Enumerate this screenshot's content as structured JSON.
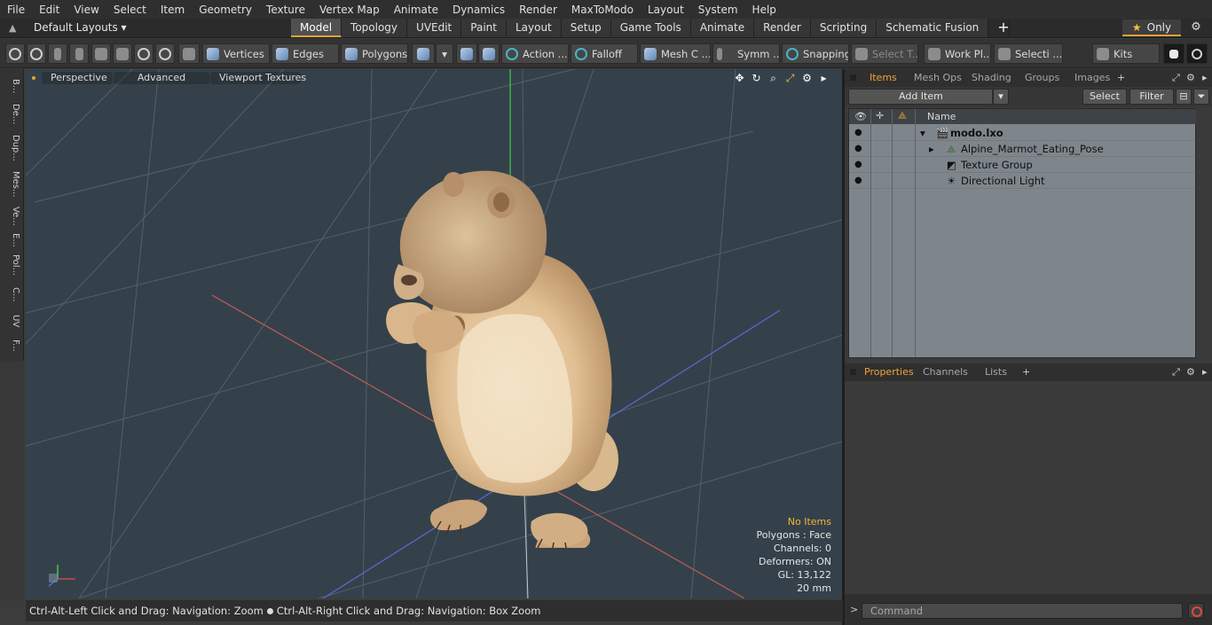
{
  "menu": [
    "File",
    "Edit",
    "View",
    "Select",
    "Item",
    "Geometry",
    "Texture",
    "Vertex Map",
    "Animate",
    "Dynamics",
    "Render",
    "MaxToModo",
    "Layout",
    "System",
    "Help"
  ],
  "layoutbar": {
    "layout_name": "Default Layouts ▾",
    "tabs": [
      "Model",
      "Topology",
      "UVEdit",
      "Paint",
      "Layout",
      "Setup",
      "Game Tools",
      "Animate",
      "Render",
      "Scripting",
      "Schematic Fusion"
    ],
    "active_tab": "Model",
    "plus": "+",
    "only_label": "Only",
    "star": "★",
    "gear": "⚙"
  },
  "toolbar": {
    "vertices": "Vertices",
    "edges": "Edges",
    "polygons": "Polygons",
    "action": "Action ...",
    "falloff": "Falloff",
    "mesh": "Mesh C ...",
    "symm": "Symm ...",
    "snapping": "Snapping",
    "select_t": "Select T...",
    "workpl": "Work Pl...",
    "selecti": "Selecti ...",
    "kits": "Kits"
  },
  "left_tabs": [
    "B...",
    "De...",
    "Dup...",
    "Mes...",
    "Ve...",
    "E...",
    "Pol...",
    "C...",
    "UV",
    "F..."
  ],
  "viewport": {
    "perspective": "Perspective",
    "advanced": "Advanced",
    "viewport_textures": "Viewport Textures",
    "stats": {
      "no_items": "No Items",
      "polygons": "Polygons : Face",
      "channels": "Channels: 0",
      "deformers": "Deformers: ON",
      "gl": "GL: 13,122",
      "size": "20 mm"
    }
  },
  "statusbar": {
    "hint_left": "Ctrl-Alt-Left Click and Drag: Navigation: Zoom",
    "hint_right": "Ctrl-Alt-Right Click and Drag: Navigation: Box Zoom"
  },
  "items_panel": {
    "tabs": [
      "Items",
      "Mesh Ops",
      "Shading",
      "Groups",
      "Images"
    ],
    "active_tab": "Items",
    "add_item": "Add Item",
    "select": "Select",
    "filter": "Filter",
    "name_header": "Name",
    "rows": [
      {
        "name": "modo.lxo"
      },
      {
        "name": "Alpine_Marmot_Eating_Pose"
      },
      {
        "name": "Texture Group"
      },
      {
        "name": "Directional Light"
      }
    ]
  },
  "properties_panel": {
    "tabs": [
      "Properties",
      "Channels",
      "Lists"
    ],
    "active_tab": "Properties"
  },
  "command": {
    "placeholder": "Command"
  },
  "colors": {
    "accent": "#e8a23a",
    "viewport_bg": "#34414a",
    "item_list_bg": "#7e868c"
  }
}
